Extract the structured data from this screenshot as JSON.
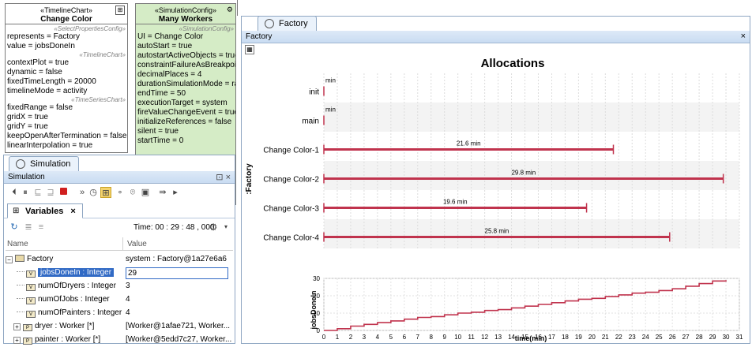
{
  "uml": {
    "timeline": {
      "stereotype": "«TimelineChart»",
      "name": "Change Color",
      "section1": "«SelectPropertiesConfig»",
      "lines1": [
        "represents = Factory",
        "value = jobsDoneIn"
      ],
      "section2": "«TimelineChart»",
      "lines2": [
        "contextPlot = true",
        "dynamic = false",
        "fixedTimeLength = 20000",
        "timelineMode = activity"
      ],
      "section3": "«TimeSeriesChart»",
      "lines3": [
        "fixedRange = false",
        "gridX = true",
        "gridY = true",
        "keepOpenAfterTermination = false",
        "linearInterpolation = true"
      ]
    },
    "simconfig": {
      "stereotype": "«SimulationConfig»",
      "name": "Many Workers",
      "section1": "«SimulationConfig»",
      "lines": [
        "UI = Change Color",
        "autoStart = true",
        "autostartActiveObjects = true",
        "constraintFailureAsBreakpoint",
        "decimalPlaces = 4",
        "durationSimulationMode = ran",
        "endTime = 50",
        "executionTarget = system",
        "fireValueChangeEvent = true",
        "initializeReferences = false",
        "silent = true",
        "startTime = 0"
      ]
    }
  },
  "factory_window": {
    "tab_label": "Factory",
    "title": "Factory",
    "close_glyph": "×"
  },
  "simulation_window": {
    "tab_label": "Simulation",
    "title": "Simulation",
    "title_controls": "⊡ ×",
    "subtab_label": "Variables",
    "subtab_close": "×",
    "time_label": "Time: 00 : 29 : 48 , 000",
    "columns": [
      "Name",
      "Value"
    ],
    "rows": [
      {
        "name": "Factory",
        "value": "system : Factory@1a27e6a6",
        "expander": "−"
      },
      {
        "name": "jobsDoneIn : Integer",
        "value": "29",
        "selected": true
      },
      {
        "name": "numOfDryers : Integer",
        "value": "3"
      },
      {
        "name": "numOfJobs : Integer",
        "value": "4"
      },
      {
        "name": "numOfPainters : Integer",
        "value": "4"
      },
      {
        "name": "dryer : Worker [*]",
        "value": "[Worker@1afae721, Worker...",
        "expander": "+"
      },
      {
        "name": "painter : Worker [*]",
        "value": "[Worker@5edd7c27, Worker...",
        "expander": "+"
      }
    ]
  },
  "chart_data": [
    {
      "type": "bar",
      "title": "Allocations",
      "ylabel": ":Factory",
      "categories": [
        "init",
        "main",
        "Change Color-1",
        "Change Color-2",
        "Change Color-3",
        "Change Color-4"
      ],
      "values": [
        0,
        0,
        21.6,
        29.8,
        19.6,
        25.8
      ],
      "data_labels": [
        "min",
        "min",
        "21.6 min",
        "29.8 min",
        "19.6 min",
        "25.8 min"
      ],
      "xlim": [
        0,
        31
      ],
      "color": "#c0334d",
      "grid": true
    },
    {
      "type": "line",
      "xlabel": "time(min)",
      "ylabel": "jobsDoneIn",
      "xlim": [
        0,
        31
      ],
      "ylim": [
        0,
        30
      ],
      "yticks": [
        0,
        10,
        20,
        30
      ],
      "xticks": [
        0,
        1,
        2,
        3,
        4,
        5,
        6,
        7,
        8,
        9,
        10,
        11,
        12,
        13,
        14,
        15,
        16,
        17,
        18,
        19,
        20,
        21,
        22,
        23,
        24,
        25,
        26,
        27,
        28,
        29,
        30,
        31
      ],
      "x": [
        0,
        1,
        2,
        3,
        4,
        5,
        6,
        7,
        8,
        9,
        10,
        11,
        12,
        13,
        14,
        15,
        16,
        17,
        18,
        19,
        20,
        21,
        22,
        23,
        24,
        25,
        26,
        27,
        28,
        29,
        30
      ],
      "y": [
        0,
        1,
        2.5,
        3.5,
        4.5,
        5.5,
        6.5,
        7.5,
        8,
        9,
        10,
        10.5,
        11.5,
        12,
        13,
        14,
        15,
        16,
        17,
        18,
        18.5,
        19.5,
        20.5,
        21.5,
        22,
        23,
        24,
        25.5,
        27,
        28.5,
        29
      ],
      "color": "#c0334d",
      "grid": true
    }
  ],
  "colors": {
    "accent": "#c0334d",
    "selection": "#316ac5",
    "sim_green": "#d5ecc6"
  }
}
